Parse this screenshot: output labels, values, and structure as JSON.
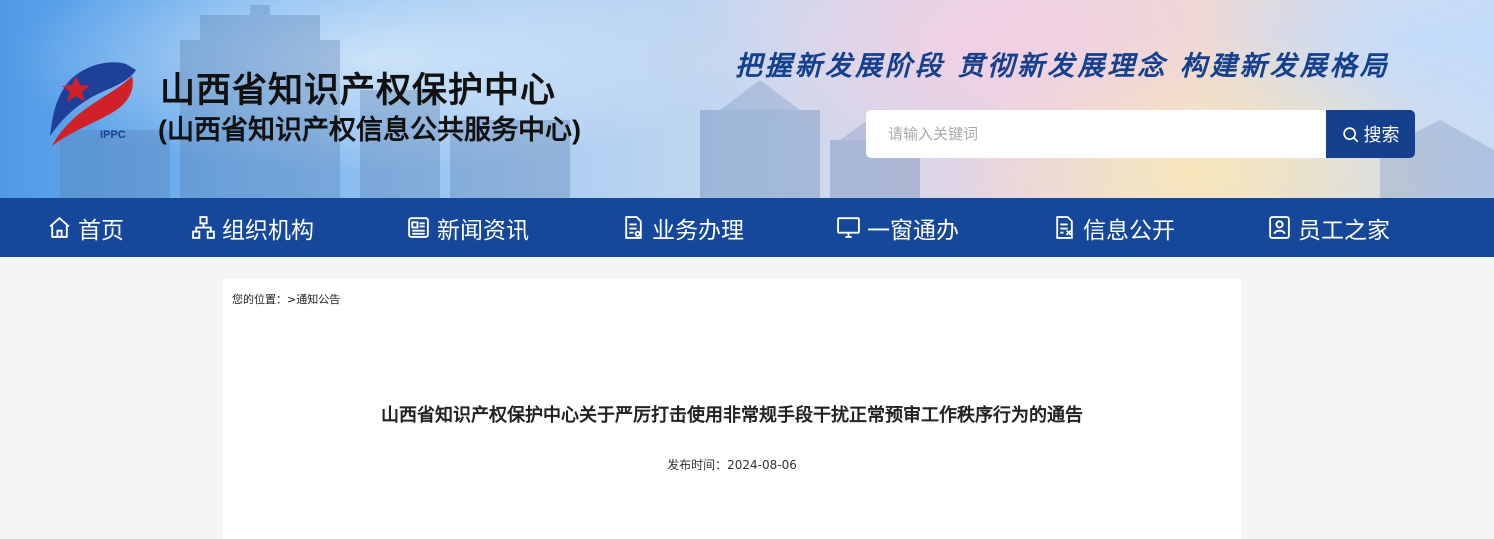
{
  "header": {
    "org_name": "山西省知识产权保护中心",
    "org_subname": "(山西省知识产权信息公共服务中心)",
    "logo_text": "IPPC",
    "slogan": "把握新发展阶段 贯彻新发展理念 构建新发展格局",
    "search": {
      "placeholder": "请输入关键词",
      "value": "",
      "button_label": "搜索"
    }
  },
  "nav": {
    "items": [
      {
        "label": "首页",
        "icon": "home-icon"
      },
      {
        "label": "组织机构",
        "icon": "org-chart-icon"
      },
      {
        "label": "新闻资讯",
        "icon": "news-icon"
      },
      {
        "label": "业务办理",
        "icon": "document-icon"
      },
      {
        "label": "一窗通办",
        "icon": "monitor-icon"
      },
      {
        "label": "信息公开",
        "icon": "info-document-icon"
      },
      {
        "label": "员工之家",
        "icon": "staff-icon"
      }
    ]
  },
  "breadcrumb": {
    "prefix": "您的位置：",
    "separator": ">",
    "current": "通知公告"
  },
  "article": {
    "title": "山西省知识产权保护中心关于严厉打击使用非常规手段干扰正常预审工作秩序行为的通告",
    "date_label": "发布时间：",
    "date": "2024-08-06"
  },
  "colors": {
    "nav_bg": "#15479a",
    "search_button": "#15408e",
    "slogan": "#15408e",
    "page_bg": "#f5f5f5"
  }
}
